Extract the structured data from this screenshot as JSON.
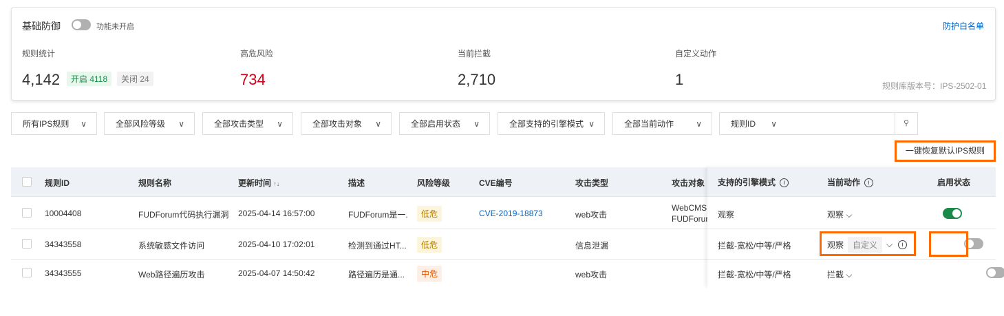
{
  "basic_defense": {
    "title": "基础防御",
    "toggle_on": false,
    "toggle_label": "功能未开启",
    "whitelist_link": "防护白名单"
  },
  "stats": {
    "rules": {
      "label": "规则统计",
      "value": "4,142",
      "enabled": "开启 4118",
      "disabled": "关闭 24"
    },
    "high_risk": {
      "label": "高危风险",
      "value": "734"
    },
    "blocking": {
      "label": "当前拦截",
      "value": "2,710"
    },
    "custom": {
      "label": "自定义动作",
      "value": "1"
    },
    "version": "规则库版本号：IPS-2502-01"
  },
  "filters": [
    "所有IPS规则",
    "全部风险等级",
    "全部攻击类型",
    "全部攻击对象",
    "全部启用状态",
    "全部支持的引擎模式",
    "全部当前动作"
  ],
  "search": {
    "field": "规则ID",
    "value": "",
    "placeholder": ""
  },
  "restore_button": "一键恢复默认IPS规则",
  "table": {
    "headers": [
      "规则ID",
      "规则名称",
      "更新时间",
      "描述",
      "风险等级",
      "CVE编号",
      "攻击类型",
      "攻击对象",
      "支持的引擎模式",
      "当前动作",
      "启用状态"
    ],
    "sort_icon": "↑↓",
    "rows": [
      {
        "id": "10004408",
        "name": "FUDForum代码执行漏洞",
        "time": "2025-04-14 16:57:00",
        "desc": "FUDForum是一.",
        "risk": "低危",
        "risk_level": "low",
        "cve": "CVE-2019-18873",
        "type": "web攻击",
        "target1": "WebCMS",
        "target2": "FUDForum",
        "engine": "观察",
        "action": "观察",
        "custom": "",
        "enabled": true
      },
      {
        "id": "34343558",
        "name": "系统敏感文件访问",
        "time": "2025-04-10 17:02:01",
        "desc": "检测到通过HT...",
        "risk": "低危",
        "risk_level": "low",
        "cve": "",
        "type": "信息泄漏",
        "target1": "",
        "target2": "",
        "engine": "拦截-宽松/中等/严格",
        "action": "观察",
        "custom": "自定义",
        "enabled": false
      },
      {
        "id": "34343555",
        "name": "Web路径遍历攻击",
        "time": "2025-04-07 14:50:42",
        "desc": "路径遍历是通...",
        "risk": "中危",
        "risk_level": "mid",
        "cve": "",
        "type": "web攻击",
        "target1": "",
        "target2": "",
        "engine": "拦截-宽松/中等/严格",
        "action": "拦截",
        "custom": "",
        "enabled": false
      }
    ]
  },
  "colors": {
    "accent": "#0064c8",
    "danger": "#d0021b",
    "success": "#1a8a4a",
    "highlight": "#ff6a00"
  }
}
